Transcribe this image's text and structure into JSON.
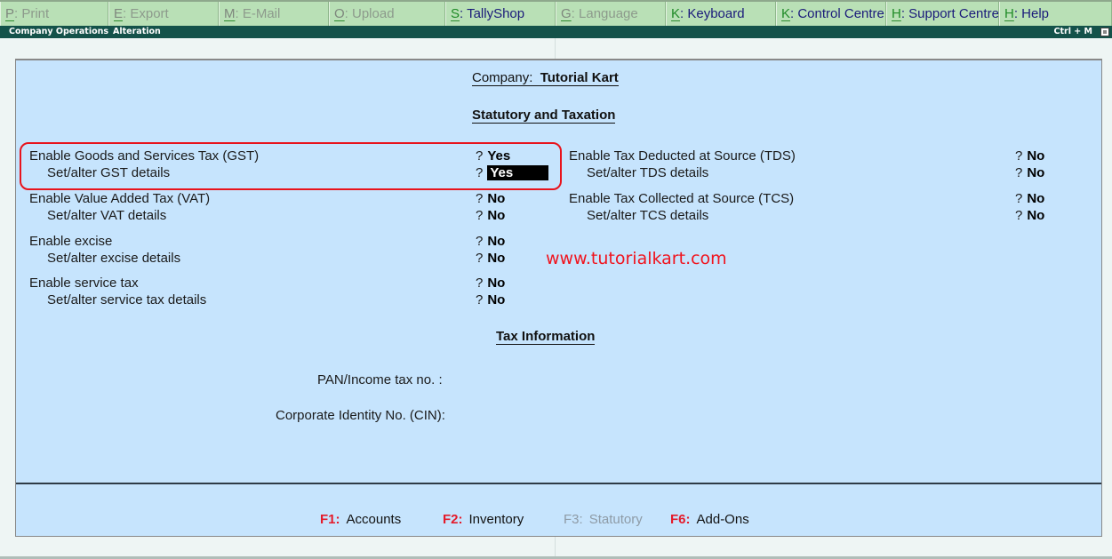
{
  "topbar": {
    "buttons": [
      {
        "key": "P",
        "label": ": Print",
        "enabled": false
      },
      {
        "key": "E",
        "label": ": Export",
        "enabled": false
      },
      {
        "key": "M",
        "label": ": E-Mail",
        "enabled": false
      },
      {
        "key": "O",
        "label": ": Upload",
        "enabled": false
      },
      {
        "key": "S",
        "label": ": TallyShop",
        "enabled": true
      },
      {
        "key": "G",
        "label": ": Language",
        "enabled": false
      },
      {
        "key": "K",
        "label": ": Keyboard",
        "enabled": true
      },
      {
        "key": "K",
        "label": ": Control Centre",
        "enabled": true
      },
      {
        "key": "H",
        "label": ": Support Centre",
        "enabled": true
      },
      {
        "key": "H",
        "label": ": Help",
        "enabled": true
      }
    ]
  },
  "titlebar": {
    "title_part1": "Company Operations",
    "title_part2": "Alteration",
    "shortcut": "Ctrl + M"
  },
  "form": {
    "company_label": "Company:",
    "company_name": "Tutorial Kart",
    "section1_title": "Statutory and Taxation",
    "question_mark": "?",
    "left_fields": [
      {
        "label": "Enable Goods and Services Tax (GST)",
        "value": "Yes"
      },
      {
        "label": "Set/alter GST details",
        "value": "Yes"
      },
      {
        "label": "Enable Value Added Tax (VAT)",
        "value": "No"
      },
      {
        "label": "Set/alter VAT details",
        "value": "No"
      },
      {
        "label": "Enable excise",
        "value": "No"
      },
      {
        "label": "Set/alter excise details",
        "value": "No"
      },
      {
        "label": "Enable service tax",
        "value": "No"
      },
      {
        "label": "Set/alter service tax details",
        "value": "No"
      }
    ],
    "right_fields": [
      {
        "label": "Enable Tax Deducted at Source (TDS)",
        "value": "No"
      },
      {
        "label": "Set/alter TDS details",
        "value": "No"
      },
      {
        "label": "Enable Tax Collected at Source (TCS)",
        "value": "No"
      },
      {
        "label": "Set/alter TCS details",
        "value": "No"
      }
    ],
    "section2_title": "Tax Information",
    "pan_label": "PAN/Income tax no. :",
    "pan_value": "",
    "cin_label": "Corporate Identity No. (CIN):",
    "cin_value": ""
  },
  "watermark": "www.tutorialkart.com",
  "footer": {
    "buttons": [
      {
        "key": "F1:",
        "label": "Accounts",
        "enabled": true
      },
      {
        "key": "F2:",
        "label": "Inventory",
        "enabled": true
      },
      {
        "key": "F3:",
        "label": "Statutory",
        "enabled": false
      },
      {
        "key": "F6:",
        "label": "Add-Ons",
        "enabled": true
      }
    ]
  },
  "colors": {
    "topbar_bg": "#b9e0b6",
    "titlebar_bg": "#14524a",
    "panel_bg": "#c6e4fd",
    "function_key": "#e41a2a",
    "highlight_border": "#e8131c",
    "watermark": "#f0141e"
  }
}
